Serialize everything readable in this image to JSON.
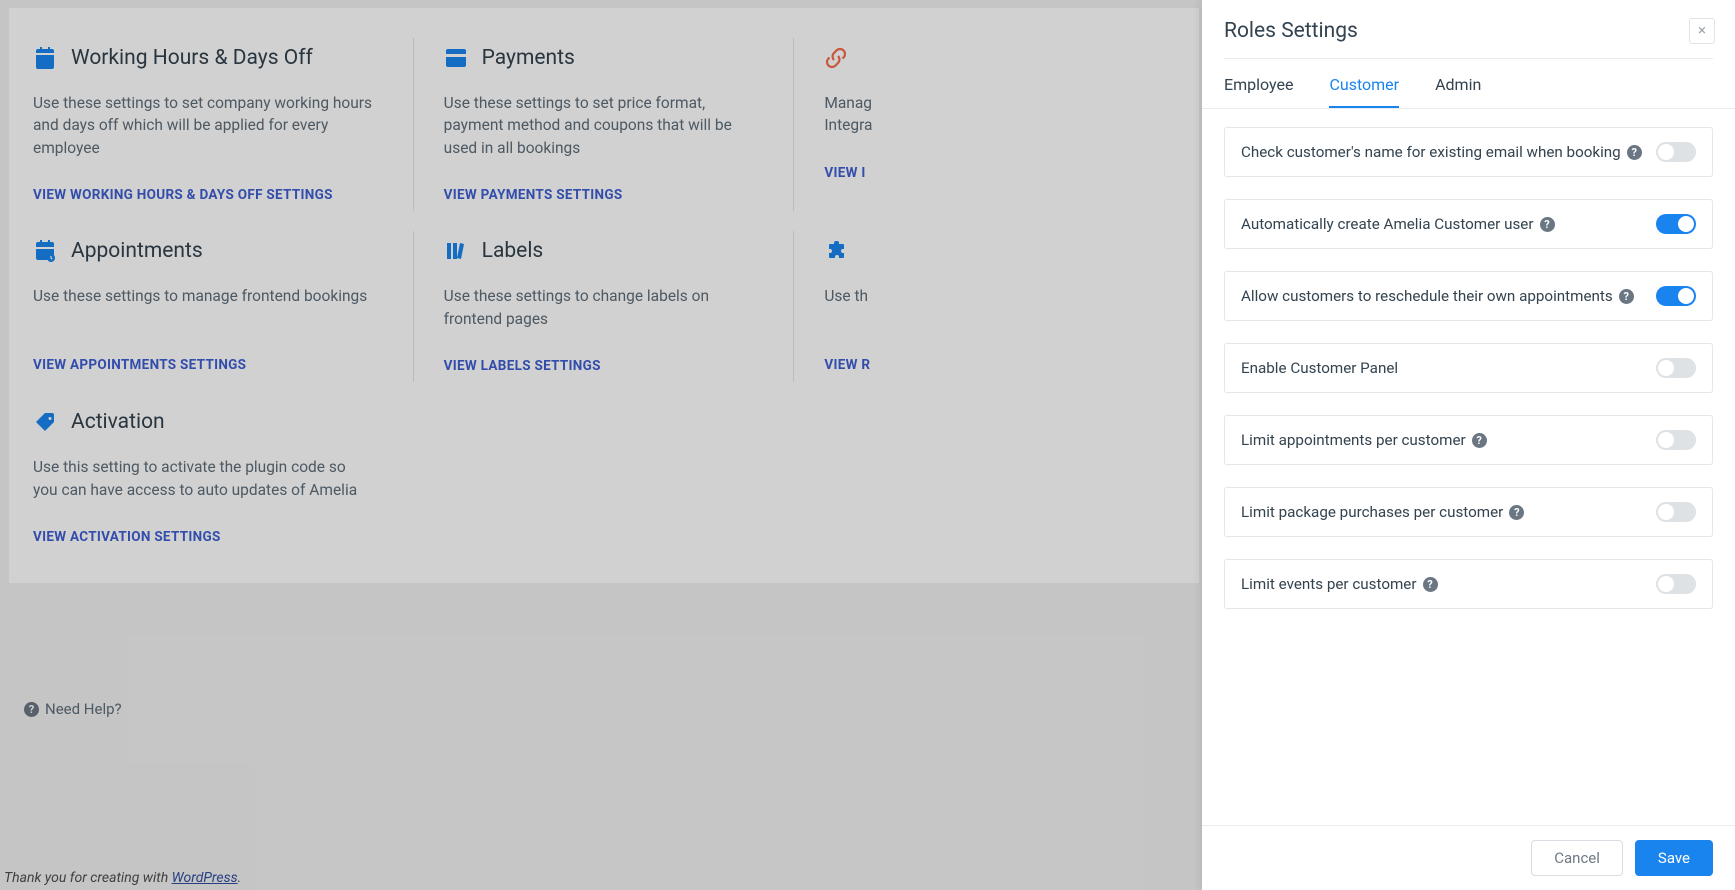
{
  "cards": {
    "workingHours": {
      "title": "Working Hours & Days Off",
      "desc": "Use these settings to set company working hours and days off which will be applied for every employee",
      "link": "VIEW WORKING HOURS & DAYS OFF SETTINGS"
    },
    "payments": {
      "title": "Payments",
      "desc": "Use these settings to set price format, payment method and coupons that will be used in all bookings",
      "link": "VIEW PAYMENTS SETTINGS"
    },
    "integrations": {
      "descPrefix": "Manag",
      "descSuffix": "Integra",
      "linkPrefix": "VIEW I"
    },
    "appointments": {
      "title": "Appointments",
      "desc": "Use these settings to manage frontend bookings",
      "link": "VIEW APPOINTMENTS SETTINGS"
    },
    "labels": {
      "title": "Labels",
      "desc": "Use these settings to change labels on frontend pages",
      "link": "VIEW LABELS SETTINGS"
    },
    "roles": {
      "descPrefix": "Use th",
      "linkPrefix": "VIEW R"
    },
    "activation": {
      "title": "Activation",
      "desc": "Use this setting to activate the plugin code so you can have access to auto updates of Amelia",
      "link": "VIEW ACTIVATION SETTINGS"
    }
  },
  "needHelp": "Need Help?",
  "footer": {
    "prefix": "Thank you for creating with ",
    "linkText": "WordPress",
    "suffix": "."
  },
  "panel": {
    "title": "Roles Settings",
    "tabs": {
      "employee": "Employee",
      "customer": "Customer",
      "admin": "Admin"
    },
    "options": [
      {
        "label": "Check customer's name for existing email when booking",
        "help": true,
        "on": false
      },
      {
        "label": "Automatically create Amelia Customer user",
        "help": true,
        "on": true
      },
      {
        "label": "Allow customers to reschedule their own appointments",
        "help": true,
        "on": true
      },
      {
        "label": "Enable Customer Panel",
        "help": false,
        "on": false
      },
      {
        "label": "Limit appointments per customer",
        "help": true,
        "on": false
      },
      {
        "label": "Limit package purchases per customer",
        "help": true,
        "on": false
      },
      {
        "label": "Limit events per customer",
        "help": true,
        "on": false
      }
    ],
    "buttons": {
      "cancel": "Cancel",
      "save": "Save"
    }
  }
}
